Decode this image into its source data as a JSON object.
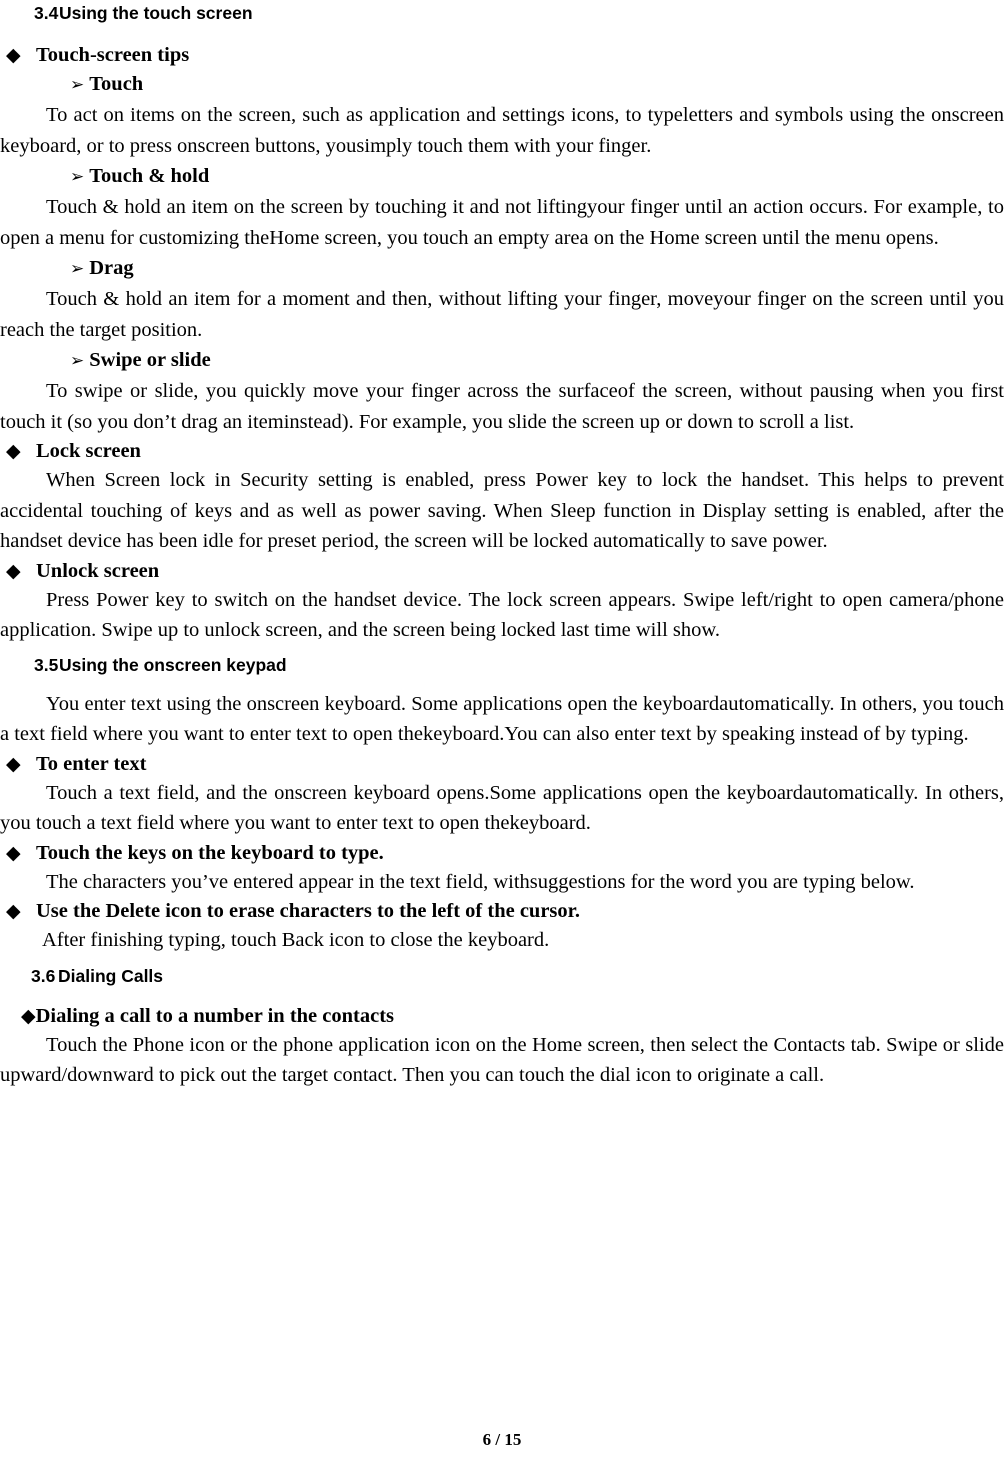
{
  "page": {
    "footer": "6 / 15",
    "bullet_diamond": "◆",
    "bullet_arrow": "➢"
  },
  "sections": [
    {
      "number": "3.4",
      "title": "Using the touch screen",
      "blocks": [
        {
          "kind": "diamond",
          "label": "Touch-screen tips"
        },
        {
          "kind": "arrow",
          "label": "Touch"
        },
        {
          "kind": "para",
          "text": "To act on items on the screen, such as application and settings icons, to typeletters and symbols using the onscreen keyboard, or to press onscreen buttons, yousimply touch them with your finger."
        },
        {
          "kind": "arrow",
          "label": "Touch & hold"
        },
        {
          "kind": "para",
          "text": "Touch & hold an item on the screen by touching it and not liftingyour finger until an action occurs. For example, to open a menu for customizing theHome screen, you touch an empty area on the Home screen until the menu opens."
        },
        {
          "kind": "arrow",
          "label": "Drag"
        },
        {
          "kind": "para",
          "text": "Touch & hold an item for a moment and then, without lifting your finger, moveyour finger on the screen until you reach the target position."
        },
        {
          "kind": "arrow",
          "label": "Swipe or slide"
        },
        {
          "kind": "para",
          "text": "To swipe or slide, you quickly move your finger across the surfaceof the screen, without pausing when you first touch it (so you don’t drag an iteminstead). For example, you slide the screen up or down to scroll a list."
        },
        {
          "kind": "diamond",
          "label": "Lock screen"
        },
        {
          "kind": "para",
          "text": "When Screen lock in Security setting is enabled, press Power key to lock the handset. This helps to prevent accidental touching of keys and as well as power saving. When Sleep function in Display setting is enabled, after the handset device has been idle for preset period, the screen will be locked automatically to save power."
        },
        {
          "kind": "diamond",
          "label": "Unlock screen"
        },
        {
          "kind": "para",
          "text": "Press Power key to switch on the handset device. The lock screen appears. Swipe left/right to open camera/phone application. Swipe up to unlock screen, and the screen being locked last time will show."
        }
      ]
    },
    {
      "number": "3.5",
      "title": "Using the onscreen keypad",
      "blocks": [
        {
          "kind": "para",
          "text": "You enter text using the onscreen keyboard. Some applications open the keyboardautomatically. In others, you touch a text field where you want to enter text to open thekeyboard.You can also enter text by speaking instead of by typing."
        },
        {
          "kind": "diamond",
          "label": "To enter text"
        },
        {
          "kind": "para",
          "text": "Touch a text field, and the onscreen keyboard opens.Some applications open the keyboardautomatically. In others, you touch a text field where you want to enter text to open thekeyboard."
        },
        {
          "kind": "diamond",
          "label": "Touch the keys on the keyboard to type."
        },
        {
          "kind": "para",
          "text": "The characters you’ve entered appear in the text field, withsuggestions for the word you are typing below."
        },
        {
          "kind": "diamond",
          "label": "Use the Delete icon to erase characters to the left of the cursor."
        },
        {
          "kind": "para",
          "text": "After finishing typing, touch Back icon to close the keyboard."
        }
      ]
    },
    {
      "number": "3.6",
      "title": "Dialing Calls",
      "blocks": [
        {
          "kind": "diamond-tight",
          "label": "Dialing a call to a number in the contacts"
        },
        {
          "kind": "para",
          "text": "Touch the Phone icon or the phone application icon on the Home screen, then select the Contacts tab. Swipe or slide upward/downward to pick out the target contact. Then you can touch the dial icon to originate a call."
        }
      ]
    }
  ]
}
